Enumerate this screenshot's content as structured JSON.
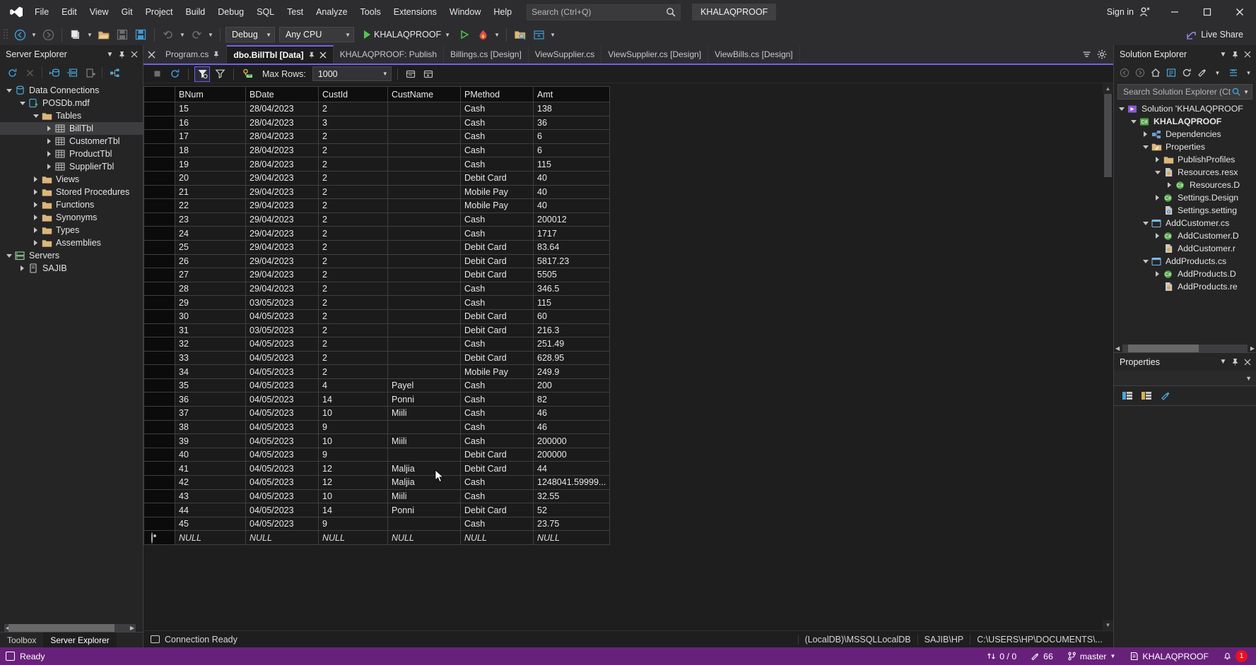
{
  "titlebar": {
    "menus": [
      "File",
      "Edit",
      "View",
      "Git",
      "Project",
      "Build",
      "Debug",
      "SQL",
      "Test",
      "Analyze",
      "Tools",
      "Extensions",
      "Window",
      "Help"
    ],
    "search_placeholder": "Search (Ctrl+Q)",
    "project_pill": "KHALAQPROOF",
    "signin_label": "Sign in",
    "minimize": "—",
    "maximize": "❐",
    "close": "✕"
  },
  "toolbar": {
    "config_combo": "Debug",
    "platform_combo": "Any CPU",
    "start_label": "KHALAQPROOF",
    "live_share": "Live Share"
  },
  "server_explorer": {
    "title": "Server Explorer",
    "tree": [
      {
        "label": "Data Connections",
        "depth": 0,
        "expander": "down",
        "icon": "database-icon",
        "selected": false
      },
      {
        "label": "POSDb.mdf",
        "depth": 1,
        "expander": "down",
        "icon": "mdf-icon",
        "selected": false
      },
      {
        "label": "Tables",
        "depth": 2,
        "expander": "down",
        "icon": "folder-icon",
        "selected": false
      },
      {
        "label": "BillTbl",
        "depth": 3,
        "expander": "right",
        "icon": "table-icon",
        "selected": true
      },
      {
        "label": "CustomerTbl",
        "depth": 3,
        "expander": "right",
        "icon": "table-icon",
        "selected": false
      },
      {
        "label": "ProductTbl",
        "depth": 3,
        "expander": "right",
        "icon": "table-icon",
        "selected": false
      },
      {
        "label": "SupplierTbl",
        "depth": 3,
        "expander": "right",
        "icon": "table-icon",
        "selected": false
      },
      {
        "label": "Views",
        "depth": 2,
        "expander": "right",
        "icon": "folder-icon",
        "selected": false
      },
      {
        "label": "Stored Procedures",
        "depth": 2,
        "expander": "right",
        "icon": "folder-icon",
        "selected": false
      },
      {
        "label": "Functions",
        "depth": 2,
        "expander": "right",
        "icon": "folder-icon",
        "selected": false
      },
      {
        "label": "Synonyms",
        "depth": 2,
        "expander": "right",
        "icon": "folder-icon",
        "selected": false
      },
      {
        "label": "Types",
        "depth": 2,
        "expander": "right",
        "icon": "folder-icon",
        "selected": false
      },
      {
        "label": "Assemblies",
        "depth": 2,
        "expander": "right",
        "icon": "folder-icon",
        "selected": false
      },
      {
        "label": "Servers",
        "depth": 0,
        "expander": "down",
        "icon": "servers-icon",
        "selected": false
      },
      {
        "label": "SAJIB",
        "depth": 1,
        "expander": "right",
        "icon": "server-icon",
        "selected": false
      }
    ],
    "bottom_tabs": [
      {
        "label": "Toolbox",
        "active": false
      },
      {
        "label": "Server Explorer",
        "active": true
      }
    ]
  },
  "document_tabs": [
    {
      "label": "Program.cs",
      "active": false,
      "pinned": true,
      "closable": false
    },
    {
      "label": "dbo.BillTbl [Data]",
      "active": true,
      "pinned": true,
      "closable": true
    },
    {
      "label": "KHALAQPROOF: Publish",
      "active": false,
      "pinned": false,
      "closable": false
    },
    {
      "label": "Billings.cs [Design]",
      "active": false,
      "pinned": false,
      "closable": false
    },
    {
      "label": "ViewSupplier.cs",
      "active": false,
      "pinned": false,
      "closable": false
    },
    {
      "label": "ViewSupplier.cs [Design]",
      "active": false,
      "pinned": false,
      "closable": false
    },
    {
      "label": "ViewBills.cs [Design]",
      "active": false,
      "pinned": false,
      "closable": false
    }
  ],
  "grid_toolbar": {
    "max_rows_label": "Max Rows:",
    "max_rows_value": "1000"
  },
  "data_grid": {
    "columns": [
      "BNum",
      "BDate",
      "CustId",
      "CustName",
      "PMethod",
      "Amt"
    ],
    "rows": [
      [
        "15",
        "28/04/2023",
        "2",
        "",
        "Cash",
        "138"
      ],
      [
        "16",
        "28/04/2023",
        "3",
        "",
        "Cash",
        "36"
      ],
      [
        "17",
        "28/04/2023",
        "2",
        "",
        "Cash",
        "6"
      ],
      [
        "18",
        "28/04/2023",
        "2",
        "",
        "Cash",
        "6"
      ],
      [
        "19",
        "28/04/2023",
        "2",
        "",
        "Cash",
        "115"
      ],
      [
        "20",
        "29/04/2023",
        "2",
        "",
        "Debit Card",
        "40"
      ],
      [
        "21",
        "29/04/2023",
        "2",
        "",
        "Mobile Pay",
        "40"
      ],
      [
        "22",
        "29/04/2023",
        "2",
        "",
        "Mobile Pay",
        "40"
      ],
      [
        "23",
        "29/04/2023",
        "2",
        "",
        "Cash",
        "200012"
      ],
      [
        "24",
        "29/04/2023",
        "2",
        "",
        "Cash",
        "1717"
      ],
      [
        "25",
        "29/04/2023",
        "2",
        "",
        "Debit Card",
        "83.64"
      ],
      [
        "26",
        "29/04/2023",
        "2",
        "",
        "Debit Card",
        "5817.23"
      ],
      [
        "27",
        "29/04/2023",
        "2",
        "",
        "Debit Card",
        "5505"
      ],
      [
        "28",
        "29/04/2023",
        "2",
        "",
        "Cash",
        "346.5"
      ],
      [
        "29",
        "03/05/2023",
        "2",
        "",
        "Cash",
        "115"
      ],
      [
        "30",
        "04/05/2023",
        "2",
        "",
        "Debit Card",
        "60"
      ],
      [
        "31",
        "03/05/2023",
        "2",
        "",
        "Debit Card",
        "216.3"
      ],
      [
        "32",
        "04/05/2023",
        "2",
        "",
        "Cash",
        "251.49"
      ],
      [
        "33",
        "04/05/2023",
        "2",
        "",
        "Debit Card",
        "628.95"
      ],
      [
        "34",
        "04/05/2023",
        "2",
        "",
        "Mobile Pay",
        "249.9"
      ],
      [
        "35",
        "04/05/2023",
        "4",
        "Payel",
        "Cash",
        "200"
      ],
      [
        "36",
        "04/05/2023",
        "14",
        "Ponni",
        "Cash",
        "82"
      ],
      [
        "37",
        "04/05/2023",
        "10",
        "Miili",
        "Cash",
        "46"
      ],
      [
        "38",
        "04/05/2023",
        "9",
        "",
        "Cash",
        "46"
      ],
      [
        "39",
        "04/05/2023",
        "10",
        "Miili",
        "Cash",
        "200000"
      ],
      [
        "40",
        "04/05/2023",
        "9",
        "",
        "Debit Card",
        "200000"
      ],
      [
        "41",
        "04/05/2023",
        "12",
        "Maljia",
        "Debit Card",
        "44"
      ],
      [
        "42",
        "04/05/2023",
        "12",
        "Maljia",
        "Cash",
        "1248041.59999..."
      ],
      [
        "43",
        "04/05/2023",
        "10",
        "Miili",
        "Cash",
        "32.55"
      ],
      [
        "44",
        "04/05/2023",
        "14",
        "Ponni",
        "Debit Card",
        "52"
      ],
      [
        "45",
        "04/05/2023",
        "9",
        "",
        "Cash",
        "23.75"
      ]
    ],
    "new_row": [
      "NULL",
      "NULL",
      "NULL",
      "NULL",
      "NULL",
      "NULL"
    ]
  },
  "connection_status": {
    "label": "Connection Ready",
    "server": "(LocalDB)\\MSSQLLocalDB",
    "machine": "SAJIB\\HP",
    "path": "C:\\USERS\\HP\\DOCUMENTS\\..."
  },
  "solution_explorer": {
    "title": "Solution Explorer",
    "search_placeholder": "Search Solution Explorer (Ct",
    "tree": [
      {
        "label": "Solution 'KHALAQPROOF",
        "depth": 0,
        "expander": "down",
        "icon": "solution-icon",
        "bold": false
      },
      {
        "label": "KHALAQPROOF",
        "depth": 1,
        "expander": "down",
        "icon": "csproj-icon",
        "bold": true
      },
      {
        "label": "Dependencies",
        "depth": 2,
        "expander": "right",
        "icon": "dependencies-icon",
        "bold": false
      },
      {
        "label": "Properties",
        "depth": 2,
        "expander": "down",
        "icon": "properties-icon",
        "bold": false
      },
      {
        "label": "PublishProfiles",
        "depth": 3,
        "expander": "right",
        "icon": "folder-icon",
        "bold": false
      },
      {
        "label": "Resources.resx",
        "depth": 3,
        "expander": "down",
        "icon": "resx-icon",
        "bold": false
      },
      {
        "label": "Resources.D",
        "depth": 4,
        "expander": "right",
        "icon": "cs-icon",
        "bold": false
      },
      {
        "label": "Settings.Design",
        "depth": 3,
        "expander": "right",
        "icon": "cs-icon",
        "bold": false
      },
      {
        "label": "Settings.setting",
        "depth": 3,
        "expander": "none",
        "icon": "settings-icon",
        "bold": false
      },
      {
        "label": "AddCustomer.cs",
        "depth": 2,
        "expander": "down",
        "icon": "form-icon",
        "bold": false
      },
      {
        "label": "AddCustomer.D",
        "depth": 3,
        "expander": "right",
        "icon": "cs-icon",
        "bold": false
      },
      {
        "label": "AddCustomer.r",
        "depth": 3,
        "expander": "none",
        "icon": "resx-icon",
        "bold": false
      },
      {
        "label": "AddProducts.cs",
        "depth": 2,
        "expander": "down",
        "icon": "form-icon",
        "bold": false
      },
      {
        "label": "AddProducts.D",
        "depth": 3,
        "expander": "right",
        "icon": "cs-icon",
        "bold": false
      },
      {
        "label": "AddProducts.re",
        "depth": 3,
        "expander": "none",
        "icon": "resx-icon",
        "bold": false
      }
    ]
  },
  "properties_panel": {
    "title": "Properties"
  },
  "statusbar": {
    "ready": "Ready",
    "source_changes": "0 / 0",
    "pending_changes": "66",
    "branch": "master",
    "repo": "KHALAQPROOF",
    "notification_count": "1"
  },
  "colors": {
    "accent_purple": "#7160e8",
    "status_purple": "#68217a",
    "titlebar_bg": "#2d2d30",
    "editor_bg": "#1e1e1e",
    "panel_bg": "#252526",
    "folder_gold": "#dcb67a",
    "run_green": "#4ec94e",
    "error_red": "#e81123"
  }
}
